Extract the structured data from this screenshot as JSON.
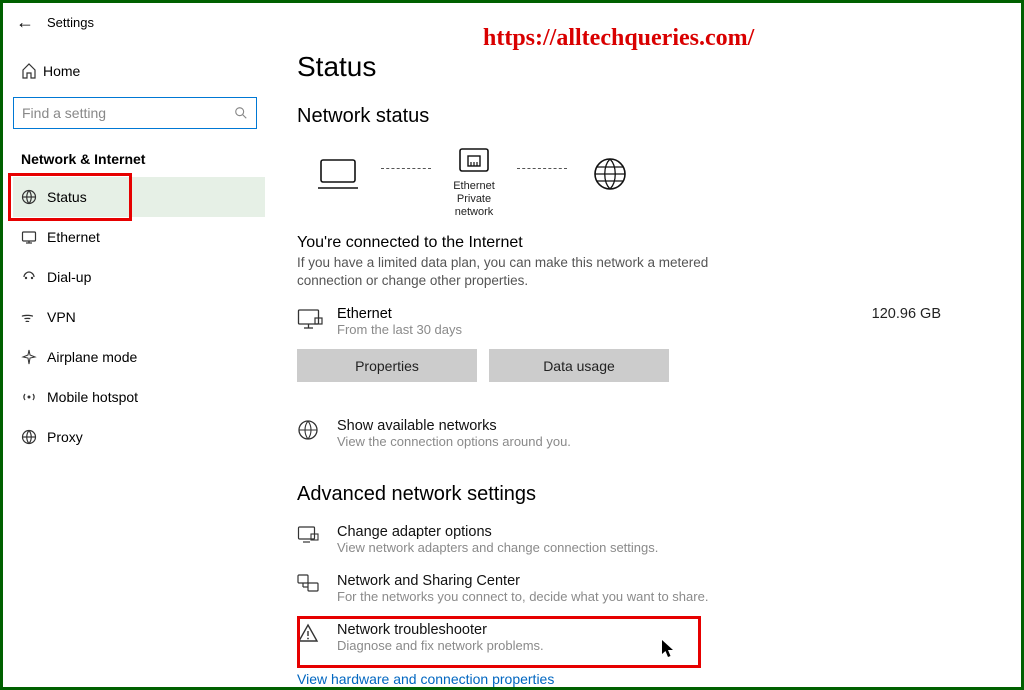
{
  "window": {
    "back": "←",
    "title": "Settings"
  },
  "watermark": "https://alltechqueries.com/",
  "sidebar": {
    "home": "Home",
    "search_placeholder": "Find a setting",
    "category": "Network & Internet",
    "items": [
      {
        "label": "Status"
      },
      {
        "label": "Ethernet"
      },
      {
        "label": "Dial-up"
      },
      {
        "label": "VPN"
      },
      {
        "label": "Airplane mode"
      },
      {
        "label": "Mobile hotspot"
      },
      {
        "label": "Proxy"
      }
    ]
  },
  "main": {
    "title": "Status",
    "network_status": "Network status",
    "diagram": {
      "ethernet": "Ethernet",
      "private": "Private network"
    },
    "connected_title": "You're connected to the Internet",
    "connected_desc": "If you have a limited data plan, you can make this network a metered connection or change other properties.",
    "connection": {
      "name": "Ethernet",
      "sub": "From the last 30 days",
      "usage": "120.96 GB"
    },
    "buttons": {
      "properties": "Properties",
      "data_usage": "Data usage"
    },
    "show_networks": {
      "title": "Show available networks",
      "sub": "View the connection options around you."
    },
    "advanced_title": "Advanced network settings",
    "adapter": {
      "title": "Change adapter options",
      "sub": "View network adapters and change connection settings."
    },
    "sharing": {
      "title": "Network and Sharing Center",
      "sub": "For the networks you connect to, decide what you want to share."
    },
    "trouble": {
      "title": "Network troubleshooter",
      "sub": "Diagnose and fix network problems."
    },
    "link": "View hardware and connection properties"
  }
}
